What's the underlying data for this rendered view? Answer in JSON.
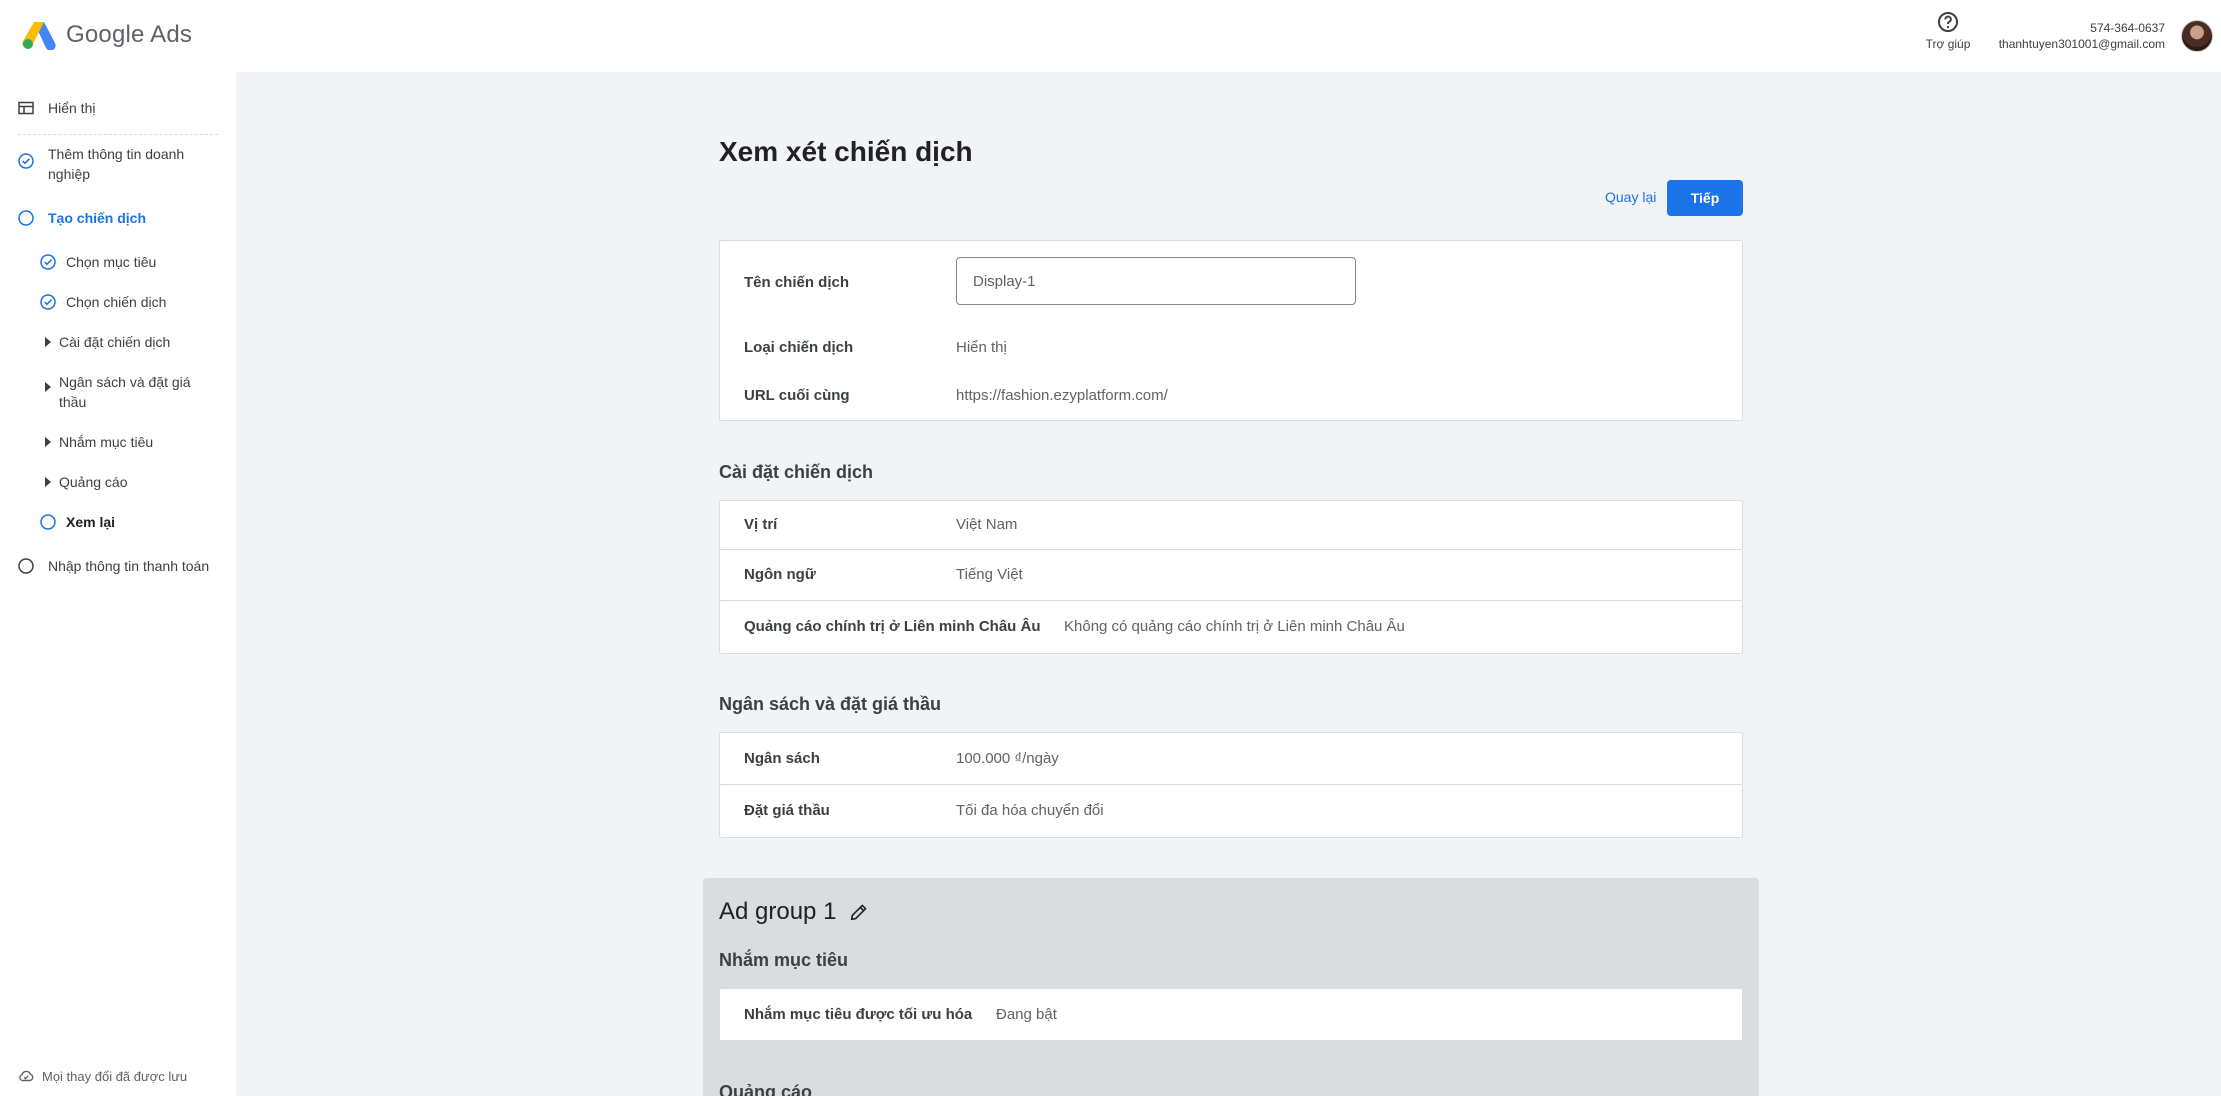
{
  "header": {
    "app_name": "Google Ads",
    "help_label": "Trợ giúp",
    "account_id": "574-364-0637",
    "account_email": "thanhtuyen301001@gmail.com",
    "icons": {
      "logo": "google-ads-logo",
      "help": "help-circle-icon",
      "avatar": "avatar"
    }
  },
  "sidebar": {
    "view_label": "Hiển thị",
    "steps": [
      {
        "label": "Thêm thông tin doanh nghiệp",
        "state": "done"
      },
      {
        "label": "Tạo chiến dịch",
        "state": "active"
      },
      {
        "label": "Nhập thông tin thanh toán",
        "state": "todo"
      }
    ],
    "substeps": [
      {
        "label": "Chọn mục tiêu",
        "state": "done"
      },
      {
        "label": "Chọn chiến dịch",
        "state": "done"
      },
      {
        "label": "Cài đặt chiến dịch",
        "state": "collapsed"
      },
      {
        "label": "Ngân sách và đặt giá thầu",
        "state": "collapsed"
      },
      {
        "label": "Nhắm mục tiêu",
        "state": "collapsed"
      },
      {
        "label": "Quảng cáo",
        "state": "collapsed"
      },
      {
        "label": "Xem lại",
        "state": "current"
      }
    ],
    "saved_status": "Mọi thay đổi đã được lưu"
  },
  "main": {
    "title": "Xem xét chiến dịch",
    "back_label": "Quay lại",
    "next_label": "Tiếp",
    "campaign": {
      "name_label": "Tên chiến dịch",
      "name_value": "Display-1",
      "type_label": "Loại chiến dịch",
      "type_value": "Hiển thị",
      "url_label": "URL cuối cùng",
      "url_value": "https://fashion.ezyplatform.com/"
    },
    "settings": {
      "title": "Cài đặt chiến dịch",
      "rows": [
        {
          "label": "Vị trí",
          "value": "Việt Nam"
        },
        {
          "label": "Ngôn ngữ",
          "value": "Tiếng Việt"
        },
        {
          "label": "Quảng cáo chính trị ở Liên minh Châu Âu",
          "value": "Không có quảng cáo chính trị ở Liên minh Châu Âu"
        }
      ]
    },
    "budget": {
      "title": "Ngân sách và đặt giá thầu",
      "rows": [
        {
          "label": "Ngân sách",
          "value": "100.000 ₫/ngày"
        },
        {
          "label": "Đặt giá thầu",
          "value": "Tối đa hóa chuyển đổi"
        }
      ]
    },
    "ad_group": {
      "title": "Ad group 1",
      "targeting_title": "Nhắm mục tiêu",
      "targeting_label": "Nhắm mục tiêu được tối ưu hóa",
      "targeting_value": "Đang bật",
      "ads_title": "Quảng cáo"
    }
  },
  "colors": {
    "accent": "#1a73e8",
    "background": "#f1f3f4",
    "ad_group_bg": "#dadce0"
  }
}
